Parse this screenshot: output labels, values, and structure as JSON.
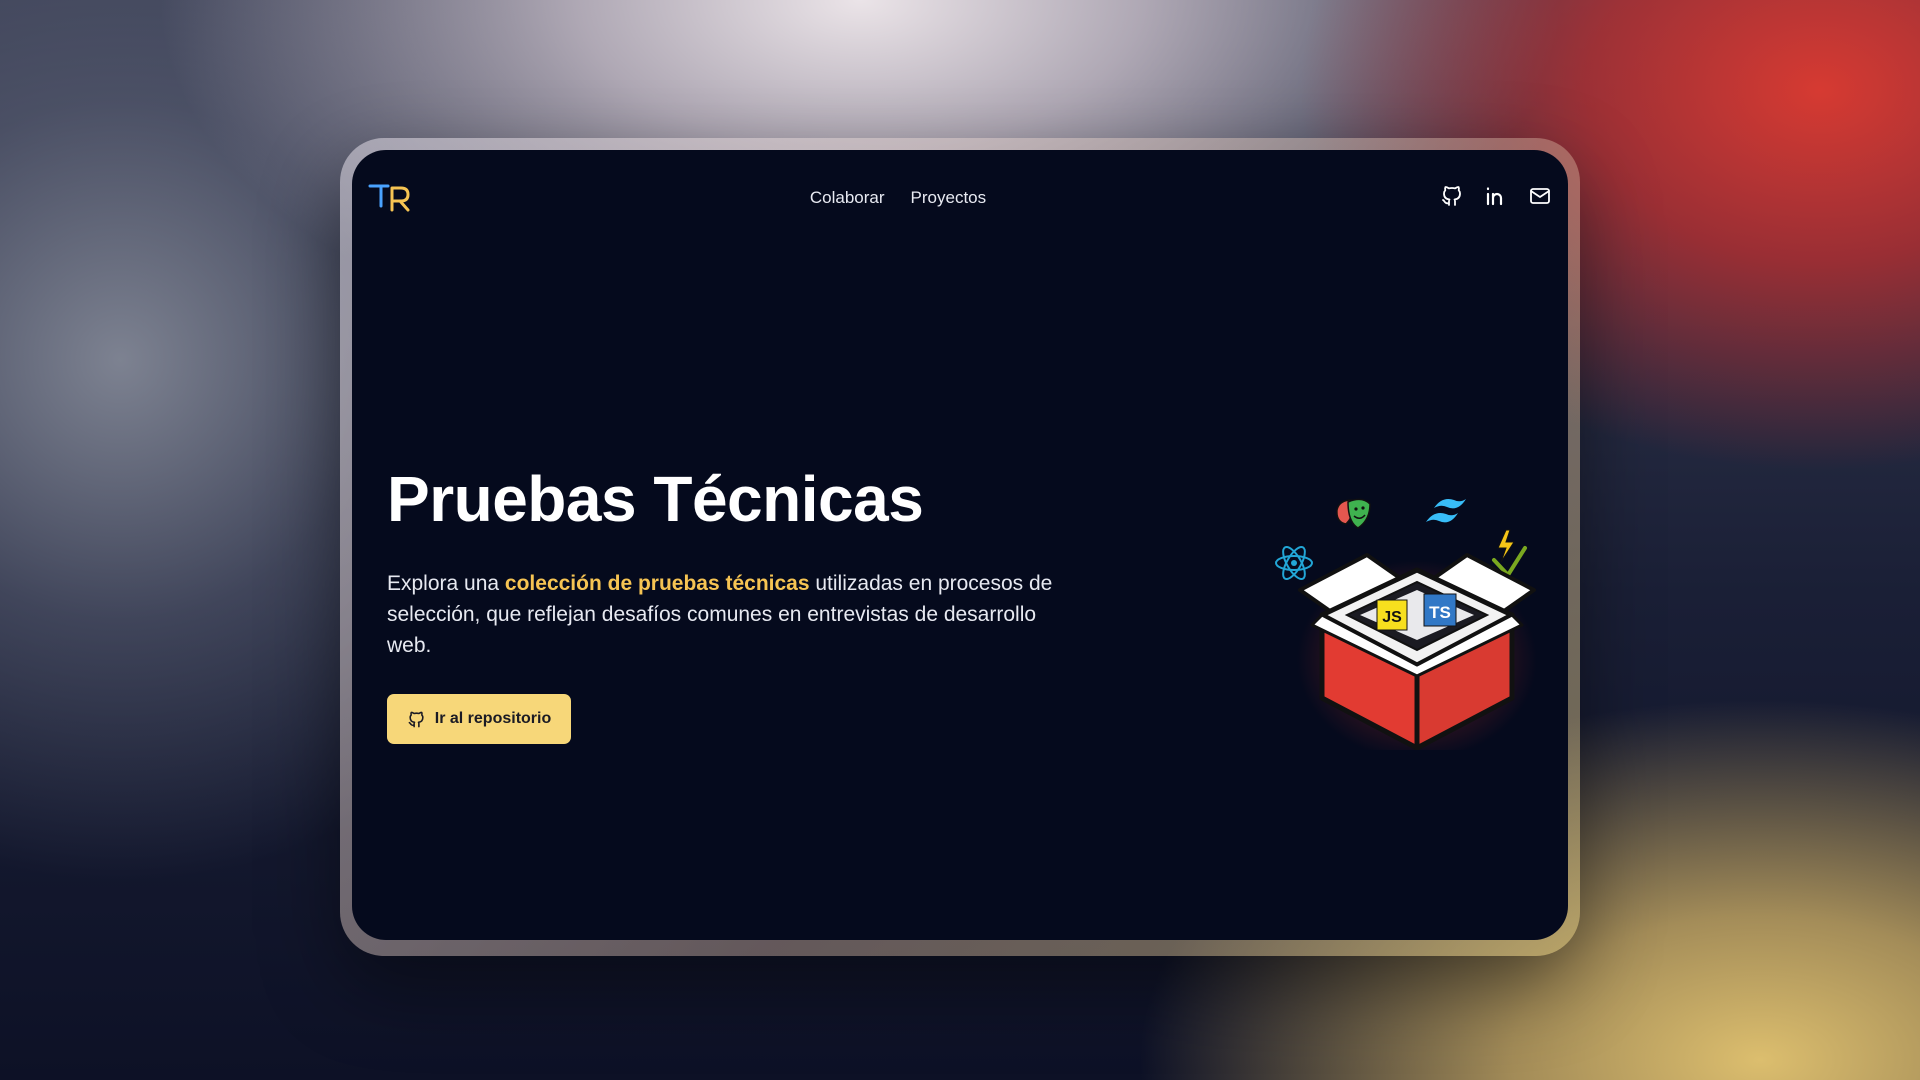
{
  "nav": {
    "links": [
      "Colaborar",
      "Proyectos"
    ],
    "logo": {
      "text": "TR",
      "colors": {
        "t": "#4aa3ff",
        "r": "#f6c453"
      }
    },
    "social_icons": [
      "github-icon",
      "linkedin-icon",
      "mail-icon"
    ]
  },
  "hero": {
    "title": "Pruebas Técnicas",
    "description_prefix": "Explora una ",
    "description_highlight": "colección de pruebas técnicas",
    "description_suffix": " utilizadas en procesos de selección, que reflejan desafíos comunes en entrevistas de desarrollo web.",
    "cta_label": "Ir al repositorio",
    "cta_icon": "github-icon"
  },
  "illustration": {
    "badges": [
      "JS",
      "TS"
    ],
    "icons": [
      "react-icon",
      "theater-masks-icon",
      "tailwind-icon",
      "vitest-icon",
      "open-box-icon"
    ]
  },
  "colors": {
    "background": "#050a1d",
    "accent": "#f6c453",
    "button": "#f7d779",
    "box_red": "#e23b32"
  }
}
